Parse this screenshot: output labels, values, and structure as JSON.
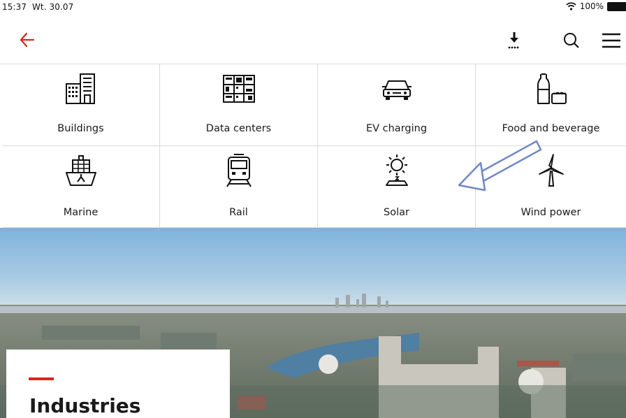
{
  "status_bar": {
    "time": "15:37",
    "date": "Wt. 30.07",
    "battery": "100%"
  },
  "toolbar": {
    "back_icon": "back-arrow-icon",
    "download_icon": "download-icon",
    "search_icon": "search-icon",
    "menu_icon": "hamburger-menu-icon",
    "accent_color": "#e2231a"
  },
  "industries": [
    {
      "label": "Buildings",
      "icon": "buildings-icon"
    },
    {
      "label": "Data centers",
      "icon": "data-centers-icon"
    },
    {
      "label": "EV charging",
      "icon": "ev-charging-icon"
    },
    {
      "label": "Food and beverage",
      "icon": "food-and-beverage-icon"
    },
    {
      "label": "Marine",
      "icon": "marine-icon"
    },
    {
      "label": "Rail",
      "icon": "rail-icon"
    },
    {
      "label": "Solar",
      "icon": "solar-icon"
    },
    {
      "label": "Wind power",
      "icon": "wind-power-icon"
    }
  ],
  "hero": {
    "title": "Industries"
  }
}
